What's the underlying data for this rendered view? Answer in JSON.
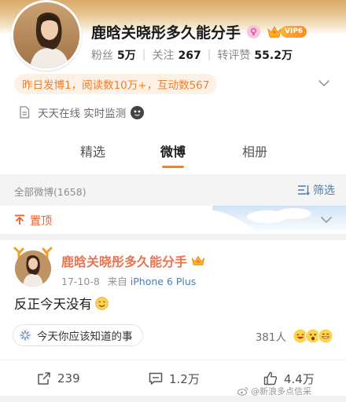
{
  "profile": {
    "name": "鹿晗关晓彤多久能分手",
    "vip_label": "VIP6",
    "stats": [
      {
        "label": "粉丝",
        "value": "5万"
      },
      {
        "label": "关注",
        "value": "267"
      },
      {
        "label": "转评赞",
        "value": "55.2万"
      }
    ],
    "activity": "昨日发博1，阅读数10万+，互动数567",
    "monitor": "天天在线 实时监测"
  },
  "tabs": [
    {
      "label": "精选",
      "active": false
    },
    {
      "label": "微博",
      "active": true
    },
    {
      "label": "相册",
      "active": false
    }
  ],
  "filter": {
    "all_posts": "全部微博(1658)",
    "filter_label": "筛选"
  },
  "pinned": {
    "label": "置顶"
  },
  "post": {
    "author": "鹿晗关晓彤多久能分手",
    "date": "17-10-8",
    "source_prefix": "来自",
    "source": "iPhone 6 Plus",
    "text": "反正今天没有",
    "topic": "今天你应该知道的事",
    "reactions_count": "381人",
    "actions": {
      "repost": "239",
      "comment": "1.2万",
      "like": "4.4万"
    }
  },
  "watermark": "@新浪多点信采",
  "colors": {
    "accent_orange": "#ff8200",
    "author_orange": "#eb7350",
    "link_blue": "#507daf",
    "pinned_red": "#ef5d2b"
  },
  "icons": [
    "female-icon",
    "crown-icon",
    "chevron-down-icon",
    "document-icon",
    "filter-icon",
    "pin-icon",
    "smile-emoji-icon",
    "topic-icon",
    "repost-icon",
    "comment-icon",
    "like-icon",
    "weibo-logo-icon"
  ]
}
